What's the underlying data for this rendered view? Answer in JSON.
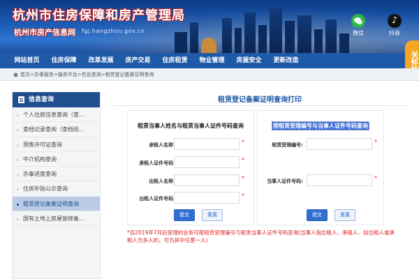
{
  "header": {
    "site_title": "杭州市住房保障和房产管理局",
    "site_subtitle": "杭州市房产信息网",
    "site_url": "fgj.hangzhou.gov.cn",
    "social": [
      {
        "label": "微信",
        "icon": "wechat-icon"
      },
      {
        "label": "抖音",
        "icon": "tiktok-icon"
      }
    ],
    "care_mode_label": "关怀版"
  },
  "nav": {
    "items": [
      "网站首页",
      "住房保障",
      "改革发展",
      "房产交易",
      "住房租赁",
      "物业管理",
      "房屋安全",
      "更新改造"
    ]
  },
  "breadcrumb": {
    "home_icon": "home-icon",
    "text": "首页>办事服务>服务平台>信息查询>租赁登记备案证明查询"
  },
  "sidebar": {
    "heading": "信息查询",
    "heading_icon": "document-icon",
    "items": [
      "个人住房信息查询（查...",
      "查档记录查询（查档验...",
      "预售许可证查询",
      "中介机构查询",
      "办事进度查询",
      "住房补贴公示查询",
      "租赁登记备案证明查询",
      "国有土地上房屋装修备..."
    ],
    "active_index": 6
  },
  "main": {
    "title": "租赁登记备案证明查询打印",
    "left_panel": {
      "heading": "租赁当事人姓名与租赁当事人证件号码查询",
      "fields": [
        {
          "label": "承租人名称:",
          "required": "*"
        },
        {
          "label": "承租人证件号码:",
          "required": "*"
        },
        {
          "label": "出租人名称:",
          "required": "*"
        },
        {
          "label": "出租人证件号码:",
          "required": "*"
        }
      ],
      "submit_label": "提交",
      "reset_label": "重置"
    },
    "right_panel": {
      "heading": "按租赁受理编号与当事人证件号码查询",
      "fields": [
        {
          "label": "租赁受理编号:",
          "required": "*"
        },
        {
          "label": "当事人证件号码:",
          "required": "*"
        }
      ],
      "submit_label": "提交",
      "reset_label": "重置"
    },
    "note": "*自2019年7月后受理的业务可按租赁受理编号与租赁当事人证件号码查询(当事人指出租人、承租人、如出租人或承租人为多人的，可为其中任意一人)"
  },
  "colors": {
    "nav_bg": "#1f5aa8",
    "sidebar_head": "#1f4f8f",
    "active_item": "#b9cbe6",
    "submit": "#2f6fd1",
    "required": "#e02020",
    "care_button": "#f5a623"
  }
}
